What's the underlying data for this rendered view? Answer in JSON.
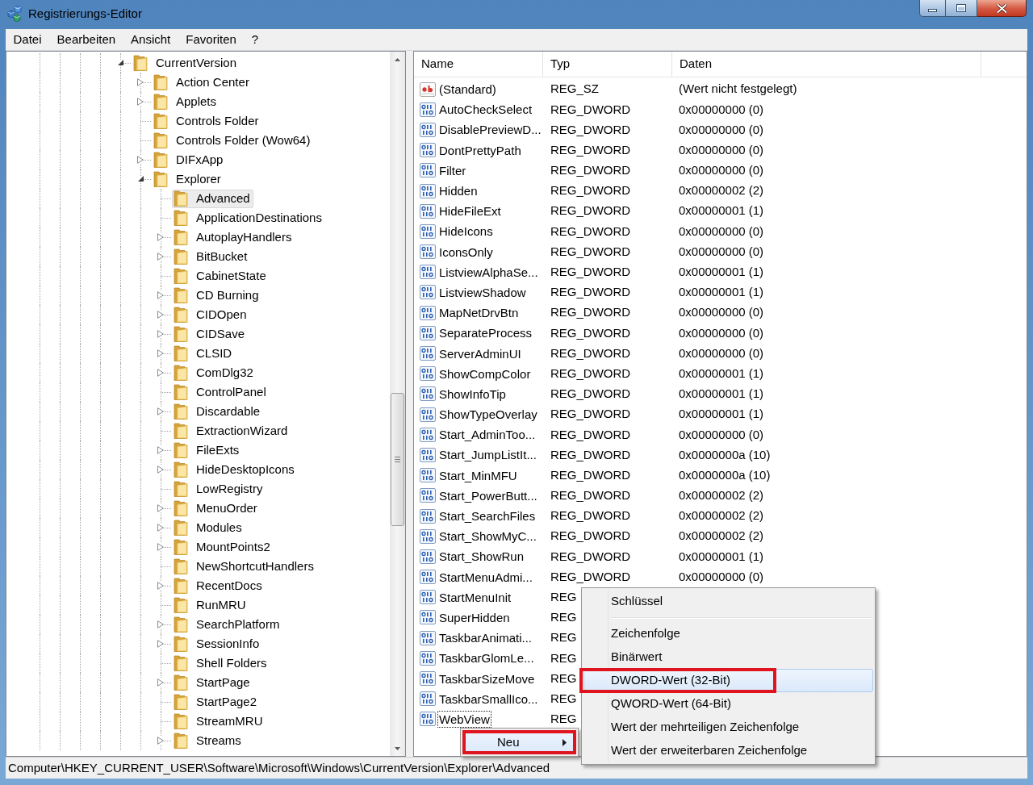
{
  "window": {
    "title": "Registrierungs-Editor"
  },
  "menu_bar": [
    {
      "label": "Datei"
    },
    {
      "label": "Bearbeiten"
    },
    {
      "label": "Ansicht"
    },
    {
      "label": "Favoriten"
    },
    {
      "label": "?"
    }
  ],
  "tree": [
    {
      "label": "CurrentVersion",
      "kind": "branch",
      "expanded": true,
      "selected": false,
      "children": [
        {
          "label": "Action Center",
          "kind": "branch",
          "expanded": false,
          "selected": false
        },
        {
          "label": "Applets",
          "kind": "branch",
          "expanded": false,
          "selected": false
        },
        {
          "label": "Controls Folder",
          "kind": "leaf",
          "selected": false
        },
        {
          "label": "Controls Folder (Wow64)",
          "kind": "leaf",
          "selected": false
        },
        {
          "label": "DIFxApp",
          "kind": "branch",
          "expanded": false,
          "selected": false
        },
        {
          "label": "Explorer",
          "kind": "branch",
          "expanded": true,
          "selected": false,
          "children": [
            {
              "label": "Advanced",
              "kind": "leaf",
              "selected": true
            },
            {
              "label": "ApplicationDestinations",
              "kind": "leaf",
              "selected": false
            },
            {
              "label": "AutoplayHandlers",
              "kind": "branch",
              "expanded": false,
              "selected": false
            },
            {
              "label": "BitBucket",
              "kind": "branch",
              "expanded": false,
              "selected": false
            },
            {
              "label": "CabinetState",
              "kind": "leaf",
              "selected": false
            },
            {
              "label": "CD Burning",
              "kind": "branch",
              "expanded": false,
              "selected": false
            },
            {
              "label": "CIDOpen",
              "kind": "branch",
              "expanded": false,
              "selected": false
            },
            {
              "label": "CIDSave",
              "kind": "branch",
              "expanded": false,
              "selected": false
            },
            {
              "label": "CLSID",
              "kind": "branch",
              "expanded": false,
              "selected": false
            },
            {
              "label": "ComDlg32",
              "kind": "branch",
              "expanded": false,
              "selected": false
            },
            {
              "label": "ControlPanel",
              "kind": "leaf",
              "selected": false
            },
            {
              "label": "Discardable",
              "kind": "branch",
              "expanded": false,
              "selected": false
            },
            {
              "label": "ExtractionWizard",
              "kind": "leaf",
              "selected": false
            },
            {
              "label": "FileExts",
              "kind": "branch",
              "expanded": false,
              "selected": false
            },
            {
              "label": "HideDesktopIcons",
              "kind": "branch",
              "expanded": false,
              "selected": false
            },
            {
              "label": "LowRegistry",
              "kind": "leaf",
              "selected": false
            },
            {
              "label": "MenuOrder",
              "kind": "branch",
              "expanded": false,
              "selected": false
            },
            {
              "label": "Modules",
              "kind": "branch",
              "expanded": false,
              "selected": false
            },
            {
              "label": "MountPoints2",
              "kind": "branch",
              "expanded": false,
              "selected": false
            },
            {
              "label": "NewShortcutHandlers",
              "kind": "leaf",
              "selected": false
            },
            {
              "label": "RecentDocs",
              "kind": "branch",
              "expanded": false,
              "selected": false
            },
            {
              "label": "RunMRU",
              "kind": "leaf",
              "selected": false
            },
            {
              "label": "SearchPlatform",
              "kind": "branch",
              "expanded": false,
              "selected": false
            },
            {
              "label": "SessionInfo",
              "kind": "branch",
              "expanded": false,
              "selected": false
            },
            {
              "label": "Shell Folders",
              "kind": "leaf",
              "selected": false
            },
            {
              "label": "StartPage",
              "kind": "branch",
              "expanded": false,
              "selected": false
            },
            {
              "label": "StartPage2",
              "kind": "leaf",
              "selected": false
            },
            {
              "label": "StreamMRU",
              "kind": "leaf",
              "selected": false
            },
            {
              "label": "Streams",
              "kind": "branch",
              "expanded": false,
              "selected": false
            }
          ]
        }
      ]
    }
  ],
  "values": {
    "columns": [
      "Name",
      "Typ",
      "Daten"
    ],
    "rows": [
      {
        "kind": "string",
        "name": "(Standard)",
        "type": "REG_SZ",
        "data": "(Wert nicht festgelegt)",
        "focused": false
      },
      {
        "kind": "dword",
        "name": "AutoCheckSelect",
        "type": "REG_DWORD",
        "data": "0x00000000 (0)",
        "focused": false
      },
      {
        "kind": "dword",
        "name": "DisablePreviewD...",
        "type": "REG_DWORD",
        "data": "0x00000000 (0)",
        "focused": false
      },
      {
        "kind": "dword",
        "name": "DontPrettyPath",
        "type": "REG_DWORD",
        "data": "0x00000000 (0)",
        "focused": false
      },
      {
        "kind": "dword",
        "name": "Filter",
        "type": "REG_DWORD",
        "data": "0x00000000 (0)",
        "focused": false
      },
      {
        "kind": "dword",
        "name": "Hidden",
        "type": "REG_DWORD",
        "data": "0x00000002 (2)",
        "focused": false
      },
      {
        "kind": "dword",
        "name": "HideFileExt",
        "type": "REG_DWORD",
        "data": "0x00000001 (1)",
        "focused": false
      },
      {
        "kind": "dword",
        "name": "HideIcons",
        "type": "REG_DWORD",
        "data": "0x00000000 (0)",
        "focused": false
      },
      {
        "kind": "dword",
        "name": "IconsOnly",
        "type": "REG_DWORD",
        "data": "0x00000000 (0)",
        "focused": false
      },
      {
        "kind": "dword",
        "name": "ListviewAlphaSe...",
        "type": "REG_DWORD",
        "data": "0x00000001 (1)",
        "focused": false
      },
      {
        "kind": "dword",
        "name": "ListviewShadow",
        "type": "REG_DWORD",
        "data": "0x00000001 (1)",
        "focused": false
      },
      {
        "kind": "dword",
        "name": "MapNetDrvBtn",
        "type": "REG_DWORD",
        "data": "0x00000000 (0)",
        "focused": false
      },
      {
        "kind": "dword",
        "name": "SeparateProcess",
        "type": "REG_DWORD",
        "data": "0x00000000 (0)",
        "focused": false
      },
      {
        "kind": "dword",
        "name": "ServerAdminUI",
        "type": "REG_DWORD",
        "data": "0x00000000 (0)",
        "focused": false
      },
      {
        "kind": "dword",
        "name": "ShowCompColor",
        "type": "REG_DWORD",
        "data": "0x00000001 (1)",
        "focused": false
      },
      {
        "kind": "dword",
        "name": "ShowInfoTip",
        "type": "REG_DWORD",
        "data": "0x00000001 (1)",
        "focused": false
      },
      {
        "kind": "dword",
        "name": "ShowTypeOverlay",
        "type": "REG_DWORD",
        "data": "0x00000001 (1)",
        "focused": false
      },
      {
        "kind": "dword",
        "name": "Start_AdminToo...",
        "type": "REG_DWORD",
        "data": "0x00000000 (0)",
        "focused": false
      },
      {
        "kind": "dword",
        "name": "Start_JumpListIt...",
        "type": "REG_DWORD",
        "data": "0x0000000a (10)",
        "focused": false
      },
      {
        "kind": "dword",
        "name": "Start_MinMFU",
        "type": "REG_DWORD",
        "data": "0x0000000a (10)",
        "focused": false
      },
      {
        "kind": "dword",
        "name": "Start_PowerButt...",
        "type": "REG_DWORD",
        "data": "0x00000002 (2)",
        "focused": false
      },
      {
        "kind": "dword",
        "name": "Start_SearchFiles",
        "type": "REG_DWORD",
        "data": "0x00000002 (2)",
        "focused": false
      },
      {
        "kind": "dword",
        "name": "Start_ShowMyC...",
        "type": "REG_DWORD",
        "data": "0x00000002 (2)",
        "focused": false
      },
      {
        "kind": "dword",
        "name": "Start_ShowRun",
        "type": "REG_DWORD",
        "data": "0x00000001 (1)",
        "focused": false
      },
      {
        "kind": "dword",
        "name": "StartMenuAdmi...",
        "type": "REG_DWORD",
        "data": "0x00000000 (0)",
        "focused": false
      },
      {
        "kind": "dword",
        "name": "StartMenuInit",
        "type": "REG",
        "focused": false
      },
      {
        "kind": "dword",
        "name": "SuperHidden",
        "type": "REG",
        "focused": false
      },
      {
        "kind": "dword",
        "name": "TaskbarAnimati...",
        "type": "REG",
        "focused": false
      },
      {
        "kind": "dword",
        "name": "TaskbarGlomLe...",
        "type": "REG",
        "focused": false
      },
      {
        "kind": "dword",
        "name": "TaskbarSizeMove",
        "type": "REG",
        "focused": false
      },
      {
        "kind": "dword",
        "name": "TaskbarSmallIco...",
        "type": "REG",
        "focused": false
      },
      {
        "kind": "dword",
        "name": "WebView",
        "type": "REG",
        "focused": true
      }
    ]
  },
  "context_menu": {
    "items": [
      {
        "label": "Neu",
        "submenu": true,
        "selected": true,
        "annotated": true
      }
    ],
    "submenu": [
      {
        "kind": "item",
        "label": "Schlüssel",
        "selected": false,
        "annotated": false
      },
      {
        "kind": "separator"
      },
      {
        "kind": "item",
        "label": "Zeichenfolge",
        "selected": false,
        "annotated": false
      },
      {
        "kind": "item",
        "label": "Binärwert",
        "selected": false,
        "annotated": false
      },
      {
        "kind": "item",
        "label": "DWORD-Wert (32-Bit)",
        "selected": true,
        "annotated": true
      },
      {
        "kind": "item",
        "label": "QWORD-Wert (64-Bit)",
        "selected": false,
        "annotated": false
      },
      {
        "kind": "item",
        "label": "Wert der mehrteiligen Zeichenfolge",
        "selected": false,
        "annotated": false
      },
      {
        "kind": "item",
        "label": "Wert der erweiterbaren Zeichenfolge",
        "selected": false,
        "annotated": false
      }
    ]
  },
  "status_bar": {
    "path": "Computer\\HKEY_CURRENT_USER\\Software\\Microsoft\\Windows\\CurrentVersion\\Explorer\\Advanced"
  }
}
